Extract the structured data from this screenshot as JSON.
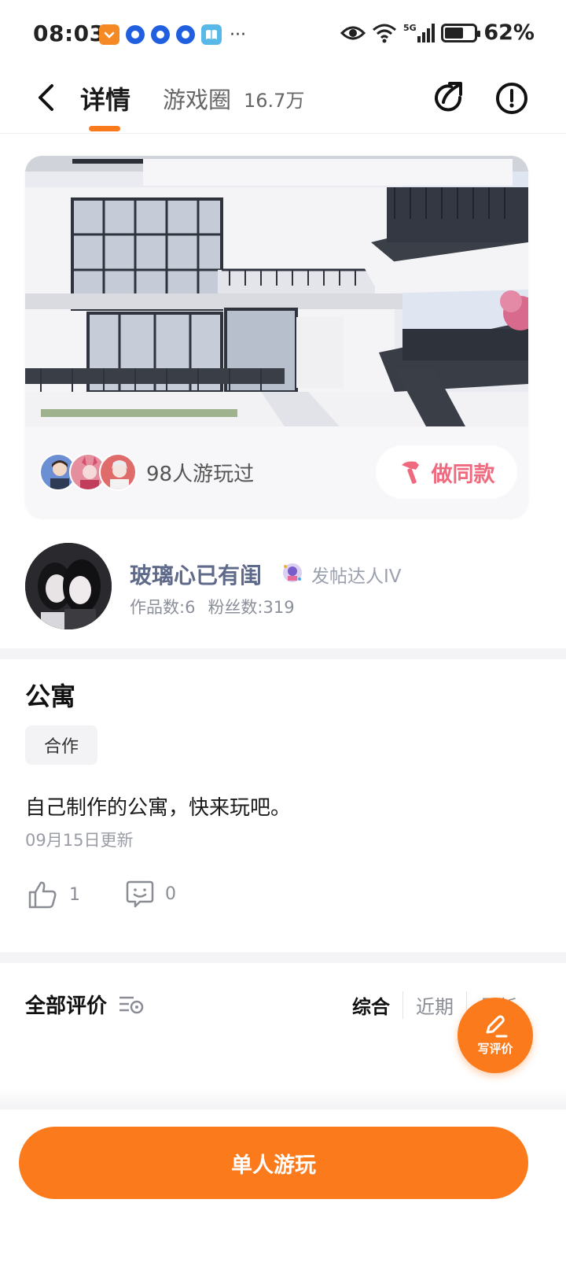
{
  "status_bar": {
    "time": "08:03",
    "dots": "···",
    "battery_percent_label": "62%",
    "battery_level": 0.62,
    "network_label": "5G"
  },
  "header": {
    "tab_detail": "详情",
    "tab_circle": "游戏圈",
    "circle_count": "16.7万",
    "accent_color": "#fb7a1c"
  },
  "game_card": {
    "players_text": "98人游玩过",
    "make_same_label": "做同款"
  },
  "author": {
    "name": "玻璃心已有闺",
    "title": "发帖达人IV",
    "works": "作品数:6",
    "fans": "粉丝数:319"
  },
  "post": {
    "title": "公寓",
    "tag": "合作",
    "description": "自己制作的公寓，快来玩吧。",
    "updated": "09月15日更新",
    "likes": "1",
    "comments": "0"
  },
  "reviews": {
    "title": "全部评价",
    "sort_options": [
      "综合",
      "近期",
      "最新"
    ],
    "write_review_label": "写评价"
  },
  "bottom": {
    "play_label": "单人游玩"
  }
}
